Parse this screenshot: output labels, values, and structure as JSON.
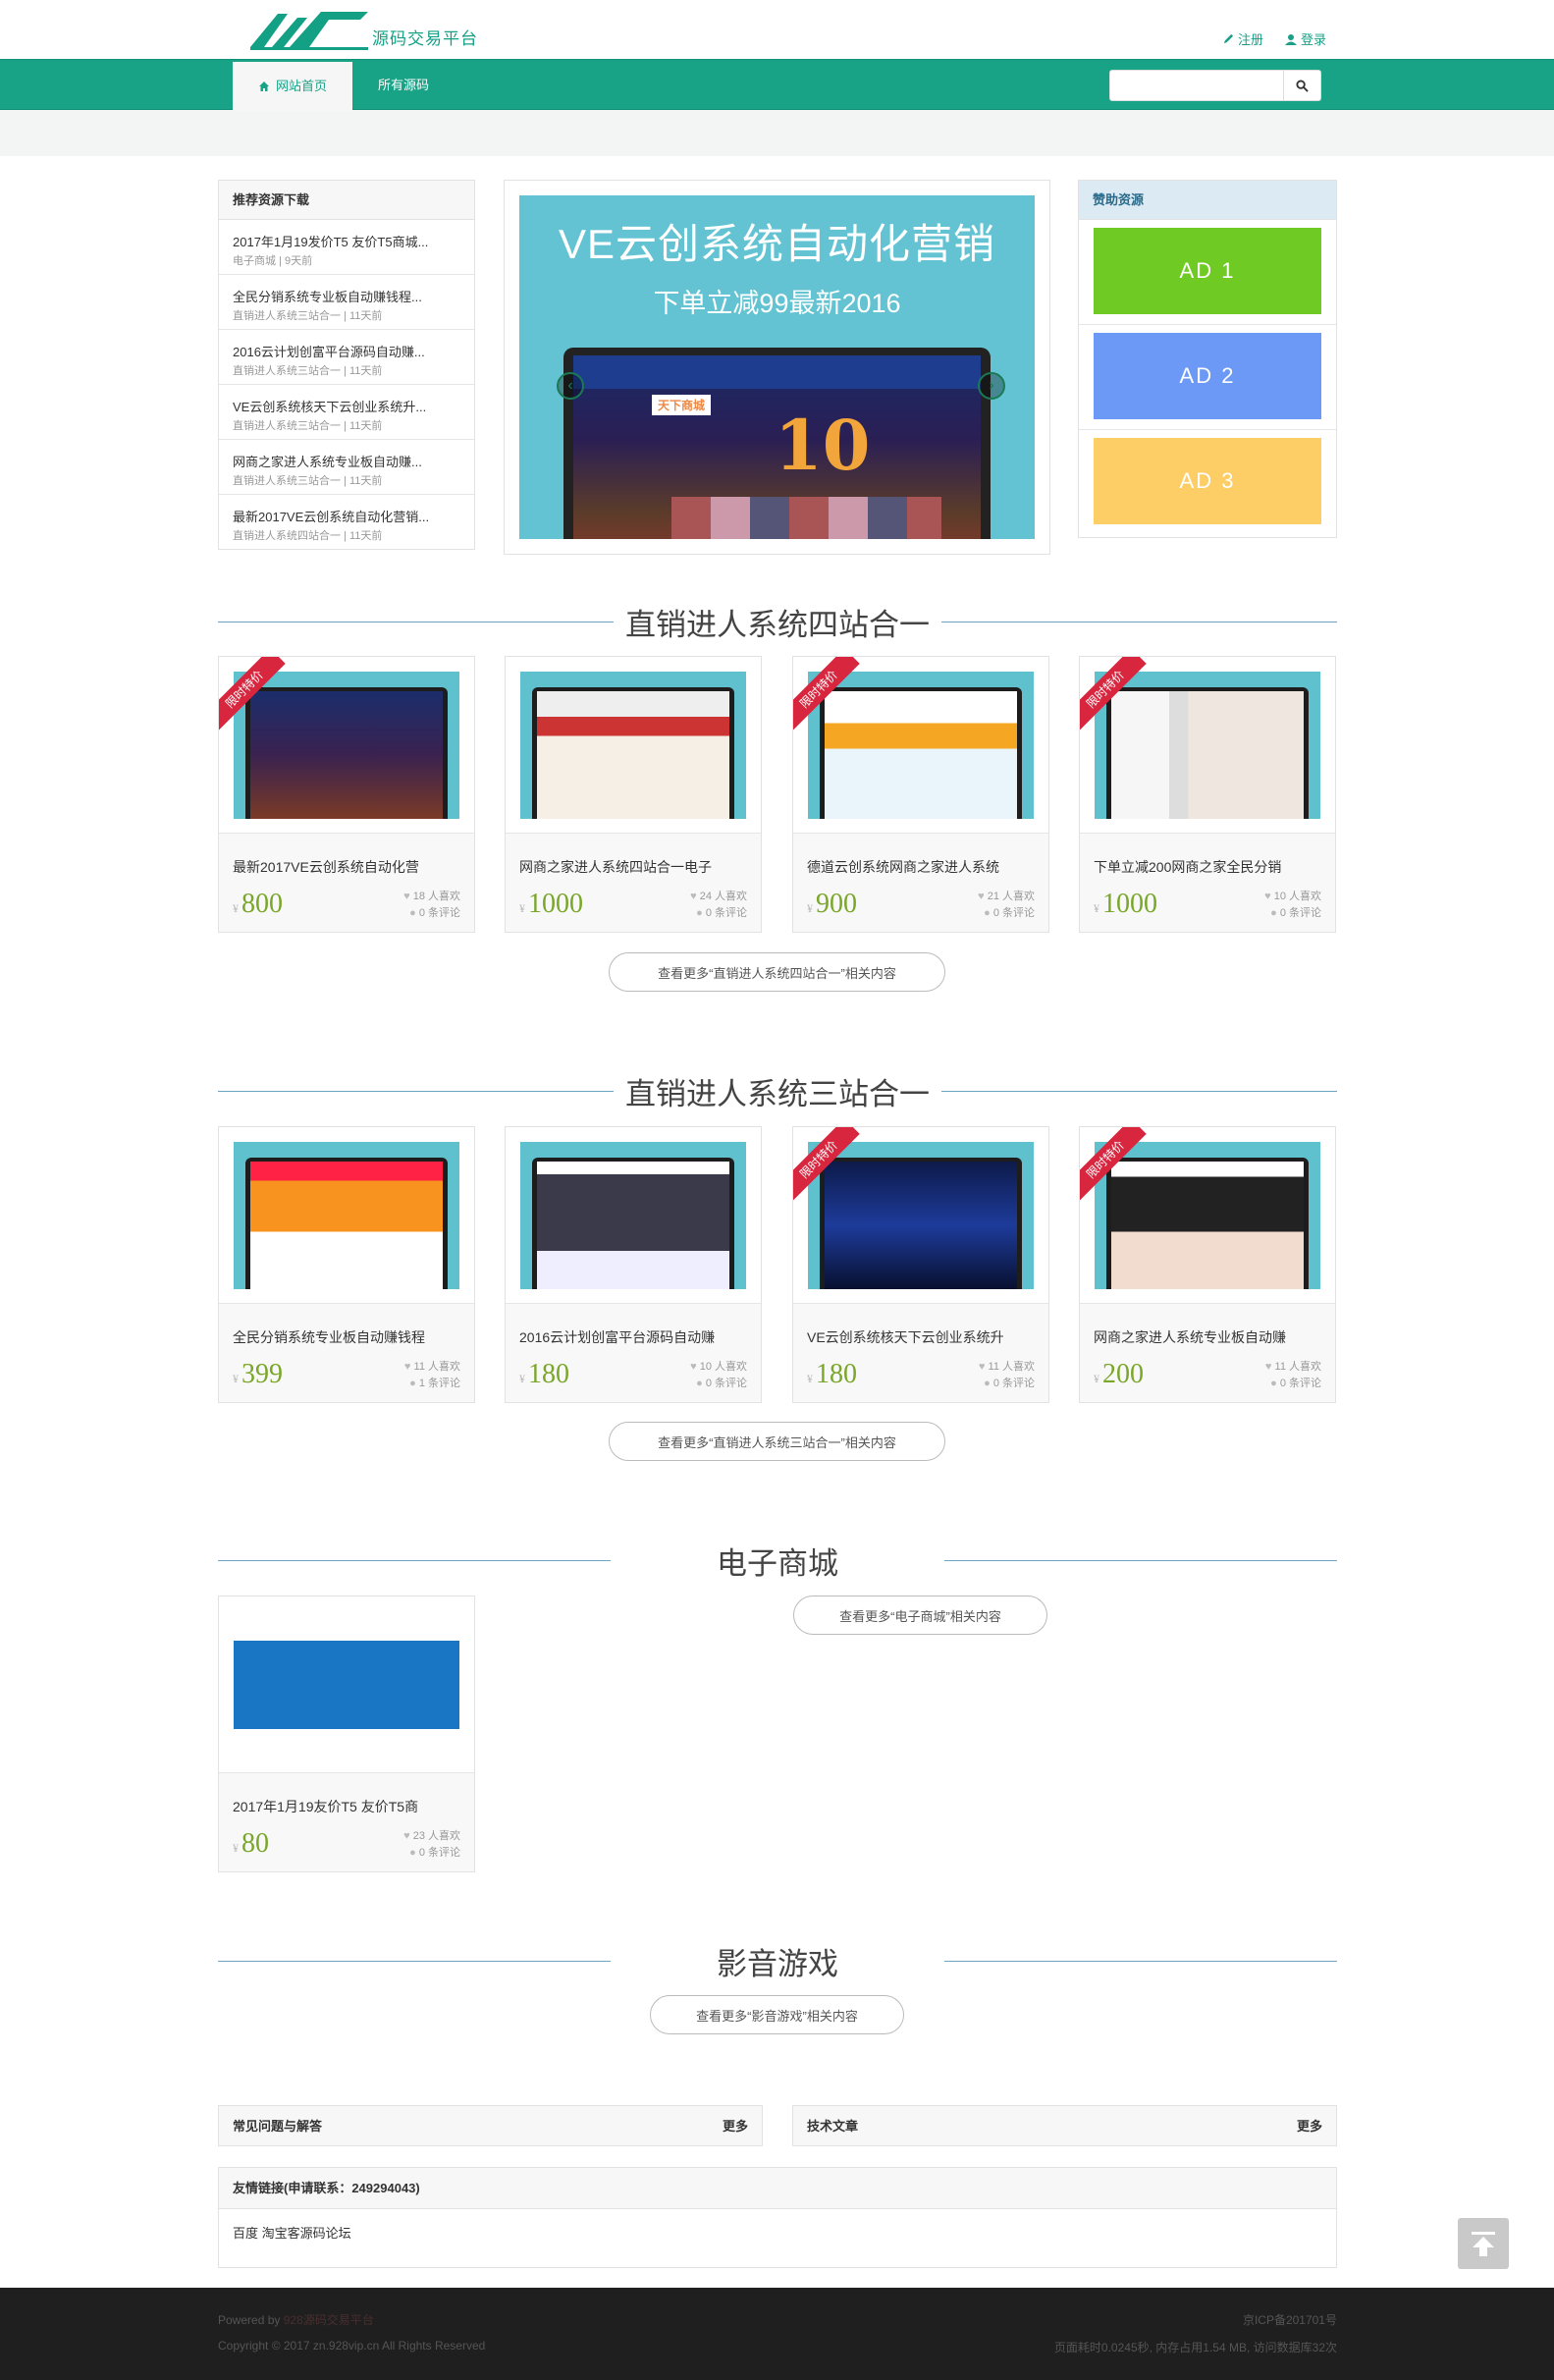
{
  "header": {
    "logo_text": "源码交易平台",
    "register": "注册",
    "login": "登录",
    "nav": [
      "网站首页",
      "所有源码"
    ],
    "search_placeholder": ""
  },
  "recommend": {
    "title": "推荐资源下载",
    "items": [
      {
        "title": "2017年1月19发价T5 友价T5商城...",
        "meta": "电子商城 | 9天前"
      },
      {
        "title": "全民分销系统专业板自动赚钱程...",
        "meta": "直销进人系统三站合一 | 11天前"
      },
      {
        "title": "2016云计划创富平台源码自动赚...",
        "meta": "直销进人系统三站合一 | 11天前"
      },
      {
        "title": "VE云创系统核天下云创业系统升...",
        "meta": "直销进人系统三站合一 | 11天前"
      },
      {
        "title": "网商之家进人系统专业板自动赚...",
        "meta": "直销进人系统三站合一 | 11天前"
      },
      {
        "title": "最新2017VE云创系统自动化营销...",
        "meta": "直销进人系统四站合一 | 11天前"
      }
    ]
  },
  "slider": {
    "headline": "VE云创系统自动化营销",
    "subline": "下单立减99最新2016",
    "screen_logo": "天下商城",
    "screen_big": "10"
  },
  "ads": {
    "title": "赞助资源",
    "items": [
      {
        "label": "AD 1",
        "color": "#6fcb23"
      },
      {
        "label": "AD 2",
        "color": "#6b99f5"
      },
      {
        "label": "AD 3",
        "color": "#fdcd66"
      }
    ]
  },
  "sections": [
    {
      "title": "直销进人系统四站合一",
      "more": "查看更多“直销进人系统四站合一”相关内容",
      "cards": [
        {
          "title": "最新2017VE云创系统自动化营",
          "price": "800",
          "likes": "18 人喜欢",
          "comments": "0 条评论",
          "ribbon": "限时特价"
        },
        {
          "title": "网商之家进人系统四站合一电子",
          "price": "1000",
          "likes": "24 人喜欢",
          "comments": "0 条评论",
          "ribbon": ""
        },
        {
          "title": "德道云创系统网商之家进人系统",
          "price": "900",
          "likes": "21 人喜欢",
          "comments": "0 条评论",
          "ribbon": "限时特价"
        },
        {
          "title": "下单立减200网商之家全民分销",
          "price": "1000",
          "likes": "10 人喜欢",
          "comments": "0 条评论",
          "ribbon": "限时特价"
        }
      ]
    },
    {
      "title": "直销进人系统三站合一",
      "more": "查看更多“直销进人系统三站合一”相关内容",
      "cards": [
        {
          "title": "全民分销系统专业板自动赚钱程",
          "price": "399",
          "likes": "11 人喜欢",
          "comments": "1 条评论",
          "ribbon": ""
        },
        {
          "title": "2016云计划创富平台源码自动赚",
          "price": "180",
          "likes": "10 人喜欢",
          "comments": "0 条评论",
          "ribbon": ""
        },
        {
          "title": "VE云创系统核天下云创业系统升",
          "price": "180",
          "likes": "11 人喜欢",
          "comments": "0 条评论",
          "ribbon": "限时特价"
        },
        {
          "title": "网商之家进人系统专业板自动赚",
          "price": "200",
          "likes": "11 人喜欢",
          "comments": "0 条评论",
          "ribbon": "限时特价"
        }
      ]
    },
    {
      "title": "电子商城",
      "more": "查看更多“电子商城”相关内容",
      "cards": [
        {
          "title": "2017年1月19友价T5 友价T5商",
          "price": "80",
          "likes": "23 人喜欢",
          "comments": "0 条评论",
          "ribbon": ""
        }
      ]
    },
    {
      "title": "影音游戏",
      "more": "查看更多“影音游戏”相关内容",
      "cards": []
    }
  ],
  "yen": "¥",
  "bottom": {
    "faq": "常见问题与解答",
    "articles": "技术文章",
    "more": "更多",
    "links_title": "友情链接(申请联系：249294043)",
    "links": "百度 淘宝客源码论坛"
  },
  "footer": {
    "powered": "Powered by",
    "powered_name": "928源码交易平台",
    "copyright": "Copyright © 2017 zn.928vip.cn All Rights Reserved",
    "icp": "京ICP备201701号",
    "stats": "页面耗时0.0245秒, 内存占用1.54 MB, 访问数据库32次"
  }
}
